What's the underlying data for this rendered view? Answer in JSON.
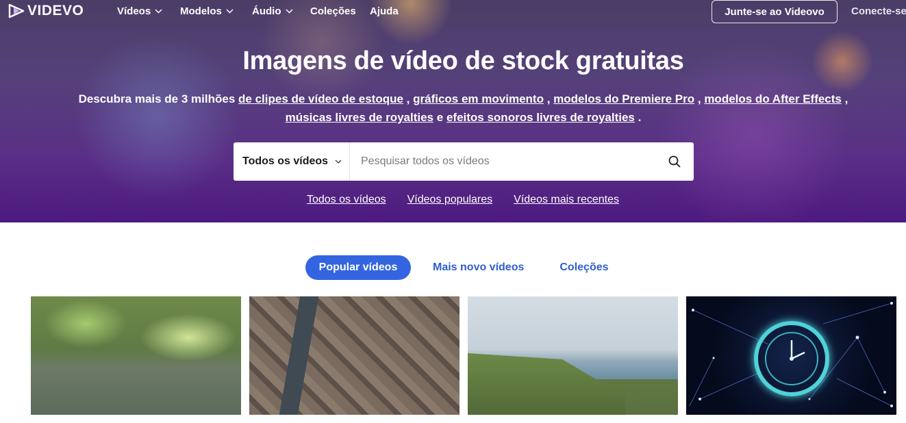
{
  "nav": {
    "logo": "VIDEVO",
    "items": [
      {
        "label": "Vídeos",
        "dropdown": true
      },
      {
        "label": "Modelos",
        "dropdown": true
      },
      {
        "label": "Áudio",
        "dropdown": true
      },
      {
        "label": "Coleções",
        "dropdown": false
      },
      {
        "label": "Ajuda",
        "dropdown": false
      }
    ],
    "join_label": "Junte-se ao Videovo",
    "login_label": "Conecte-se"
  },
  "hero": {
    "title": "Imagens de vídeo de stock gratuitas",
    "subtitle": {
      "prefix": "Descubra mais de 3 milhões",
      "links": [
        "de clipes de vídeo de estoque",
        "gráficos em movimento",
        "modelos do Premiere Pro",
        "modelos do After Effects",
        "músicas livres de royalties",
        "efeitos sonoros livres de royalties"
      ],
      "sep": ",",
      "conj": "e",
      "end": "."
    }
  },
  "search": {
    "category": "Todos os vídeos",
    "placeholder": "Pesquisar todos os vídeos"
  },
  "quick_links": [
    "Todos os vídeos",
    "Vídeos populares",
    "Vídeos mais recentes"
  ],
  "tabs": [
    {
      "label": "Popular vídeos",
      "active": true
    },
    {
      "label": "Mais novo vídeos",
      "active": false
    },
    {
      "label": "Coleções",
      "active": false
    }
  ],
  "colors": {
    "accent": "#3465e0",
    "tab_text": "#2f5fd0"
  }
}
